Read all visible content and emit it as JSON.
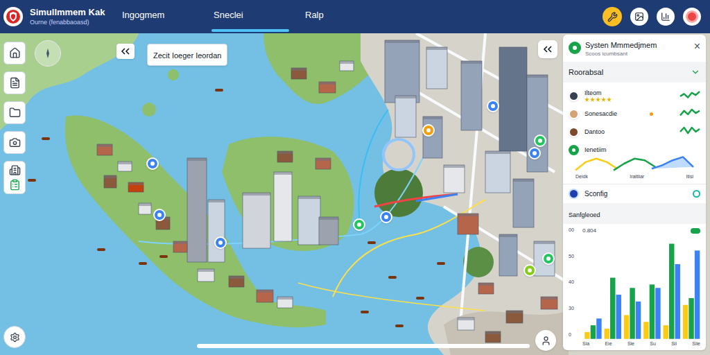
{
  "header": {
    "title": "Simullmmem Kak",
    "subtitle": "Ourne (fenabbaoasd)"
  },
  "nav": [
    {
      "label": "Ingogmem",
      "selected": false
    },
    {
      "label": "Sneclei",
      "selected": true
    },
    {
      "label": "Ralp",
      "selected": false
    }
  ],
  "search": {
    "value": "Zecit Ioeger Ieordan"
  },
  "map": {
    "pins": [
      {
        "color": "#f59e0b"
      },
      {
        "color": "#3b82f6"
      },
      {
        "color": "#3b82f6"
      },
      {
        "color": "#22c55e"
      },
      {
        "color": "#22c55e"
      },
      {
        "color": "#3b82f6"
      },
      {
        "color": "#3b82f6"
      },
      {
        "color": "#3b82f6"
      },
      {
        "color": "#3b82f6"
      },
      {
        "color": "#84cc16"
      },
      {
        "color": "#22c55e"
      }
    ]
  },
  "panel": {
    "title": "Systen Mmmedjmem",
    "subtitle": "Scoos icumbsant",
    "close": "×",
    "section": {
      "label": "Roorabsal",
      "expanded": true
    },
    "items": [
      {
        "label": "Ilteom",
        "kind": "stars",
        "stars": 5,
        "color": "#374151",
        "trend": [
          3,
          5,
          2,
          6,
          4,
          7
        ]
      },
      {
        "label": "Sonesacdie",
        "kind": "dot",
        "dot": "#f59e0b",
        "color": "#d4a373",
        "trend": [
          2,
          6,
          3,
          7,
          4,
          6
        ]
      },
      {
        "label": "Dantoo",
        "kind": "plain",
        "color": "#7c4a2d",
        "trend": [
          3,
          6,
          2,
          6,
          3,
          5
        ]
      }
    ],
    "gauge": {
      "label": "Ienetiim",
      "labels": [
        "Deidk",
        "Iraltiiar",
        "Itisi"
      ],
      "series": [
        {
          "color": "#facc15",
          "values": [
            1,
            6,
            8,
            6,
            2
          ]
        },
        {
          "color": "#16a34a",
          "values": [
            1,
            5,
            8,
            7,
            3
          ]
        },
        {
          "color": "#3b82f6",
          "values": [
            2,
            4,
            7,
            9,
            3
          ]
        }
      ]
    },
    "config": {
      "label": "Sconfig",
      "on": false
    },
    "chart": {
      "title": "Sanfgleoed",
      "value": "0.804",
      "y_ticks": [
        "00",
        "50",
        "40",
        "30",
        "0"
      ],
      "x_labels": [
        "Sia",
        "Eie",
        "Sie",
        "Su",
        "Sii",
        "Siie"
      ],
      "max": 60,
      "series": [
        {
          "color": "#facc15",
          "values": [
            4,
            6,
            14,
            10,
            8,
            20
          ]
        },
        {
          "color": "#16a34a",
          "values": [
            8,
            36,
            30,
            32,
            56,
            24
          ]
        },
        {
          "color": "#3b82f6",
          "values": [
            12,
            26,
            22,
            30,
            44,
            52
          ]
        }
      ]
    }
  }
}
